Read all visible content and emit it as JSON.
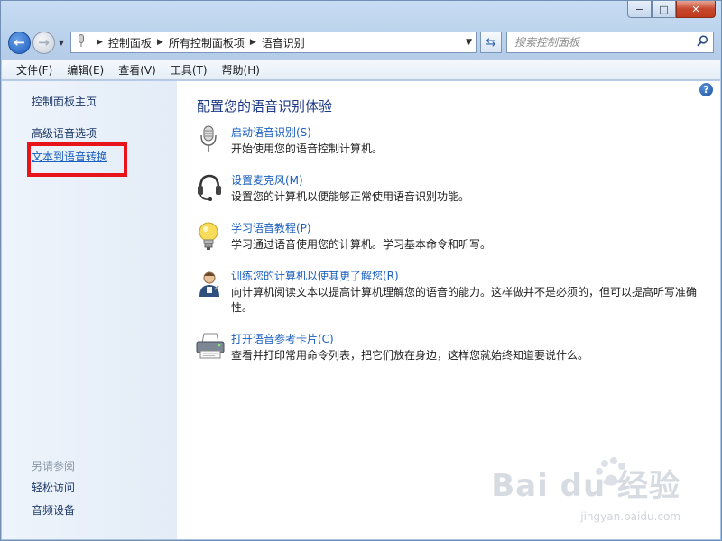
{
  "window": {
    "caption": {
      "minimize": "−",
      "maximize": "□",
      "close": "✕"
    }
  },
  "navigation": {
    "address_crumbs": [
      "控制面板",
      "所有控制面板项",
      "语音识别"
    ],
    "search_placeholder": "搜索控制面板"
  },
  "menu": [
    "文件(F)",
    "编辑(E)",
    "查看(V)",
    "工具(T)",
    "帮助(H)"
  ],
  "left_pane": {
    "home": "控制面板主页",
    "links": [
      "高级语音选项",
      "文本到语音转换"
    ],
    "see_also_heading": "另请参阅",
    "see_also": [
      "轻松访问",
      "音频设备"
    ]
  },
  "main": {
    "title": "配置您的语音识别体验",
    "tasks": [
      {
        "icon": "microphone-icon",
        "link": "启动语音识别(S)",
        "desc": "开始使用您的语音控制计算机。"
      },
      {
        "icon": "headset-icon",
        "link": "设置麦克风(M)",
        "desc": "设置您的计算机以便能够正常使用语音识别功能。"
      },
      {
        "icon": "lightbulb-icon",
        "link": "学习语音教程(P)",
        "desc": "学习通过语音使用您的计算机。学习基本命令和听写。"
      },
      {
        "icon": "user-train-icon",
        "link": "训练您的计算机以使其更了解您(R)",
        "desc": "向计算机阅读文本以提高计算机理解您的语音的能力。这样做并不是必须的，但可以提高听写准确性。"
      },
      {
        "icon": "printer-icon",
        "link": "打开语音参考卡片(C)",
        "desc": "查看并打印常用命令列表，把它们放在身边，这样您就始终知道要说什么。"
      }
    ]
  },
  "watermark": {
    "brand": "Bai du 经验",
    "url": "jingyan.baidu.com"
  },
  "colors": {
    "link": "#1a5fbf",
    "title": "#1e3a87",
    "highlight": "#e8141b"
  }
}
